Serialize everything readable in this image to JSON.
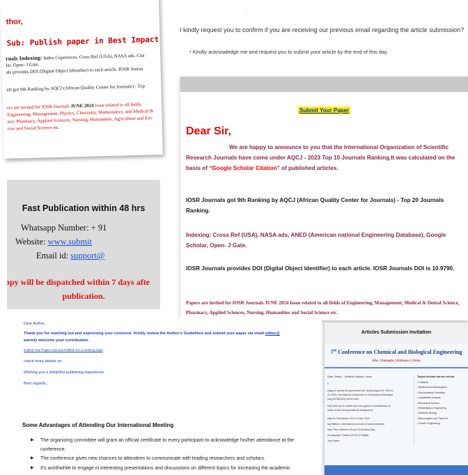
{
  "panel_a": {
    "greeting": "thor,",
    "subject": "Sub: Publish paper in Best Impact Factor Journal",
    "indexing_label": "rnals Indexing:",
    "indexing_text": "Index Copernicus, Cross Ref (USA), NASA ads, Cita",
    "indexing_line2": "lar, Open- J Gate.",
    "doi_line": "als provides DOI (Digital Object Identifier) to each article. IOSR Journa",
    "ranking_line": "als got 9th Ranking by AQCJ (African Quality Center for Journals) - Top",
    "papers_line1_pre": "ers are invited for IOSR Journals ",
    "papers_line1_bold": "JUNE 2024",
    "papers_line1_post": " Issue related to all fields",
    "papers_line2": "Engineering, Management, Physics, Chemistry, Mathematics, and Medical &",
    "papers_line3": "nce, Pharmacy, Applied Sciences, Nursing, Humanities, Agriculture and Env",
    "papers_line4": "row and Social Science etc."
  },
  "panel_b": {
    "dot": "˙",
    "request": "I kindly request you to confirm if you are receiving our previous email regarding the article submission?",
    "acknowledge": "¹ Kindly acknowledge me and request you to submit your article by the end of this day."
  },
  "panel_c": {
    "heading": "Fast Publication within 48 hrs",
    "whatsapp": "Whatsapp Number: + 91",
    "website_label": "Website: ",
    "website_link": "www.submit",
    "email_label": "Email id: ",
    "email_link": "support@",
    "dispatch_line1": "opy will be dispatched within 7 days afte",
    "dispatch_line2": "publication."
  },
  "panel_d": {
    "button": "Submit Your Paper",
    "dear": "Dear Sir,",
    "intro_pre": "We are happy to announce to you that the International Organization of Scientific Research Journals have come under AQCJ - 2023 Top 10 Journals Ranking.It was calculated on the basis of ",
    "intro_hl": "“Google Scholar Citation”",
    "intro_post": " of published articles.",
    "ranking": "IOSR Journals got 9th Ranking by AQCJ (African Quality Center for Journals) - Top 20 Journals Ranking.",
    "indexing": "Indexing: Cross Ref (USA), NASA ads,  ANED (American national Engineering Database), Google Scholar, Open- J Gate.",
    "doi": "IOSR Journals provides DOI (Digital Object Identifier) to each article. IOSR Journals DOI is 10.9790.",
    "papers": "Papers are invited for IOSR Journals JUNE 2024 Issue related to all fields of Engineering, Management, Medical & Dental Science, Pharmacy, Applied Sciences, Nursing, Humanities and Social Science etc."
  },
  "panel_e": {
    "dear": "Dear Author,",
    "thanks": "Thank you for reaching out and expressing your concerns. Kindly review the Author's Guidelines and submit your paper via email ",
    "thanks_link": "editor@",
    "welcome": "warmly welcome your contribution.",
    "submit_link": "Submit Your Paper now and Publish it in 3 working days",
    "check": "check more details on:",
    "wishing": "Wishing you a delightful publishing experience.",
    "regards": "Best regards,",
    "section": "Some Advantages of Attending Our International Meeting",
    "bullets": [
      "The organizing committee will grant an official certificate to every participant to acknowledge his/her attendance at the conference.",
      "The conference gives new chances to attendees to communicate with leading researchers and scholars.",
      "It's worthwhile to engage in interesting presentations and discussions on different topics for increasing the academic attainments of your research field."
    ]
  },
  "panel_f": {
    "header": "Articles Submission Invitation",
    "conf_num": "7",
    "conf_sup": "th",
    "conf_title": " Conference on Chemical and Biological Engineering",
    "city": "Site: Chengdu | Sichuan | China",
    "left_lines": [
      "Dutta, Ghana ... Wetsthuh Kakatho, Lesya.",
      "e",
      "happy to spread the good news that, during August 22, 2024 to",
      "24, 2024, International Conference on Chemical and Biological",
      "ring (ICCBE2024) will be held.",
      "fully invite you to submit your new papers in consideration of",
      "vance of your strong academic background.",
      "Date for Submission: 20% of June, 2024",
      "ing Platform: International Journals (3 ranked indexed)",
      "ance Time: Between 15 and 20 Working Days",
      "al Language: Chinese (M IC) or English",
      "Your Paper:"
    ],
    "topics_header": "Topics include but are not lim",
    "topics": [
      "Catalysis",
      "Medicinal and Bioinorganic",
      "Environmental Chemistry",
      "Quantitative Analysis",
      "Biomedical Sensors",
      "Rehabilitation Engineering",
      "Synthetic Biology",
      "Bioenergetics and Tissue M",
      "Genetic Engineering"
    ]
  }
}
